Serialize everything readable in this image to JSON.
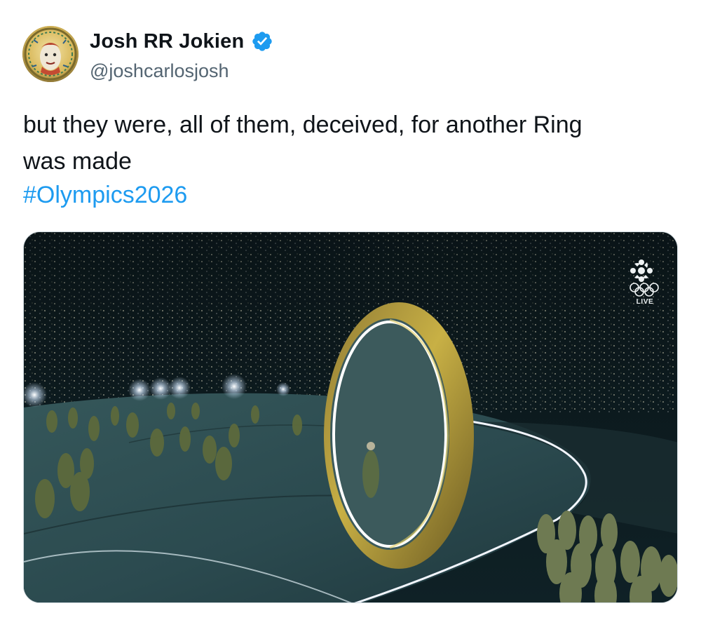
{
  "author": {
    "display_name": "Josh RR Jokien",
    "handle": "@joshcarlosjosh",
    "verified": true,
    "verified_icon": "verified-badge-icon",
    "verified_color": "#1d9bf0"
  },
  "post": {
    "text_lines": [
      "but they were, all of them, deceived, for another Ring",
      "was made"
    ],
    "hashtag": "#Olympics2026",
    "hashtag_color": "#1d9bf0"
  },
  "media": {
    "broadcast_overlay": {
      "network_icon": "cbc-gem-icon",
      "rings_icon": "olympic-rings-icon",
      "live_label": "LIVE"
    }
  }
}
